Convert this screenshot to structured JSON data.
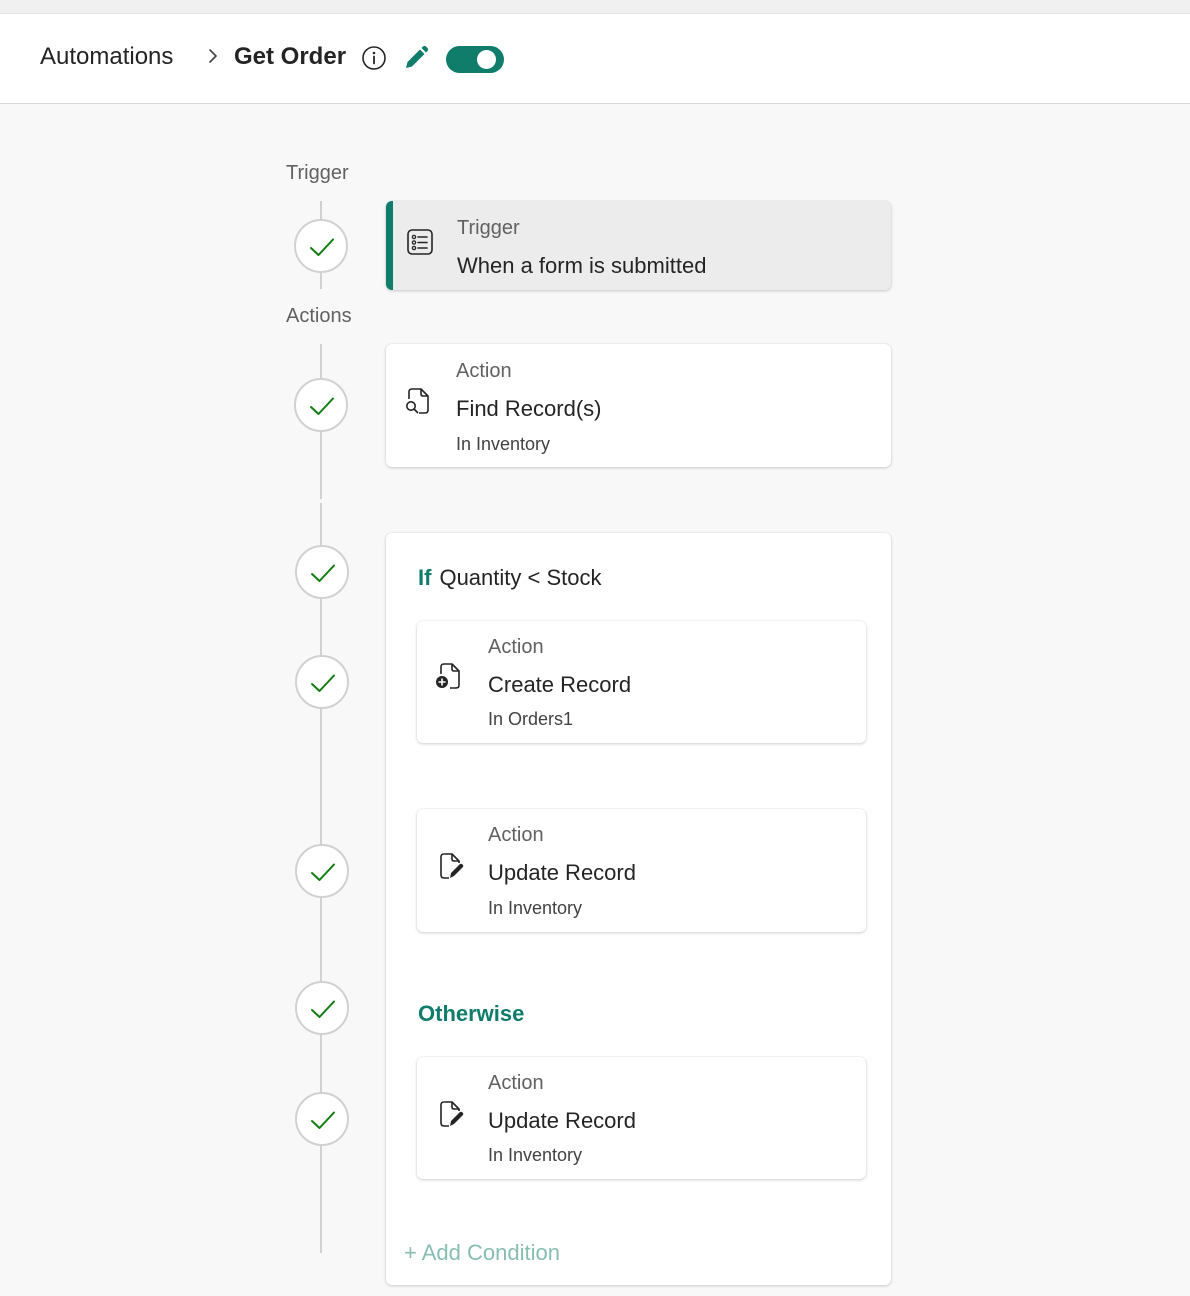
{
  "header": {
    "breadcrumb_root": "Automations",
    "title": "Get Order",
    "toggle_on": true
  },
  "colors": {
    "accent": "#107c6a",
    "check": "#107c10",
    "add_condition": "#88bdb3"
  },
  "labels": {
    "trigger_section": "Trigger",
    "actions_section": "Actions"
  },
  "trigger": {
    "kind": "Trigger",
    "title": "When a form is submitted",
    "icon": "form-list-icon"
  },
  "find_action": {
    "kind": "Action",
    "title": "Find Record(s)",
    "sub": "In Inventory",
    "icon": "document-search-icon"
  },
  "condition": {
    "if_keyword": "If",
    "expression": "Quantity < Stock",
    "then_actions": [
      {
        "kind": "Action",
        "title": "Create Record",
        "sub": "In Orders1",
        "icon": "document-add-icon"
      },
      {
        "kind": "Action",
        "title": "Update Record",
        "sub": "In Inventory",
        "icon": "document-edit-icon"
      }
    ],
    "otherwise_label": "Otherwise",
    "otherwise_actions": [
      {
        "kind": "Action",
        "title": "Update Record",
        "sub": "In Inventory",
        "icon": "document-edit-icon"
      }
    ],
    "add_condition": "+ Add Condition"
  }
}
